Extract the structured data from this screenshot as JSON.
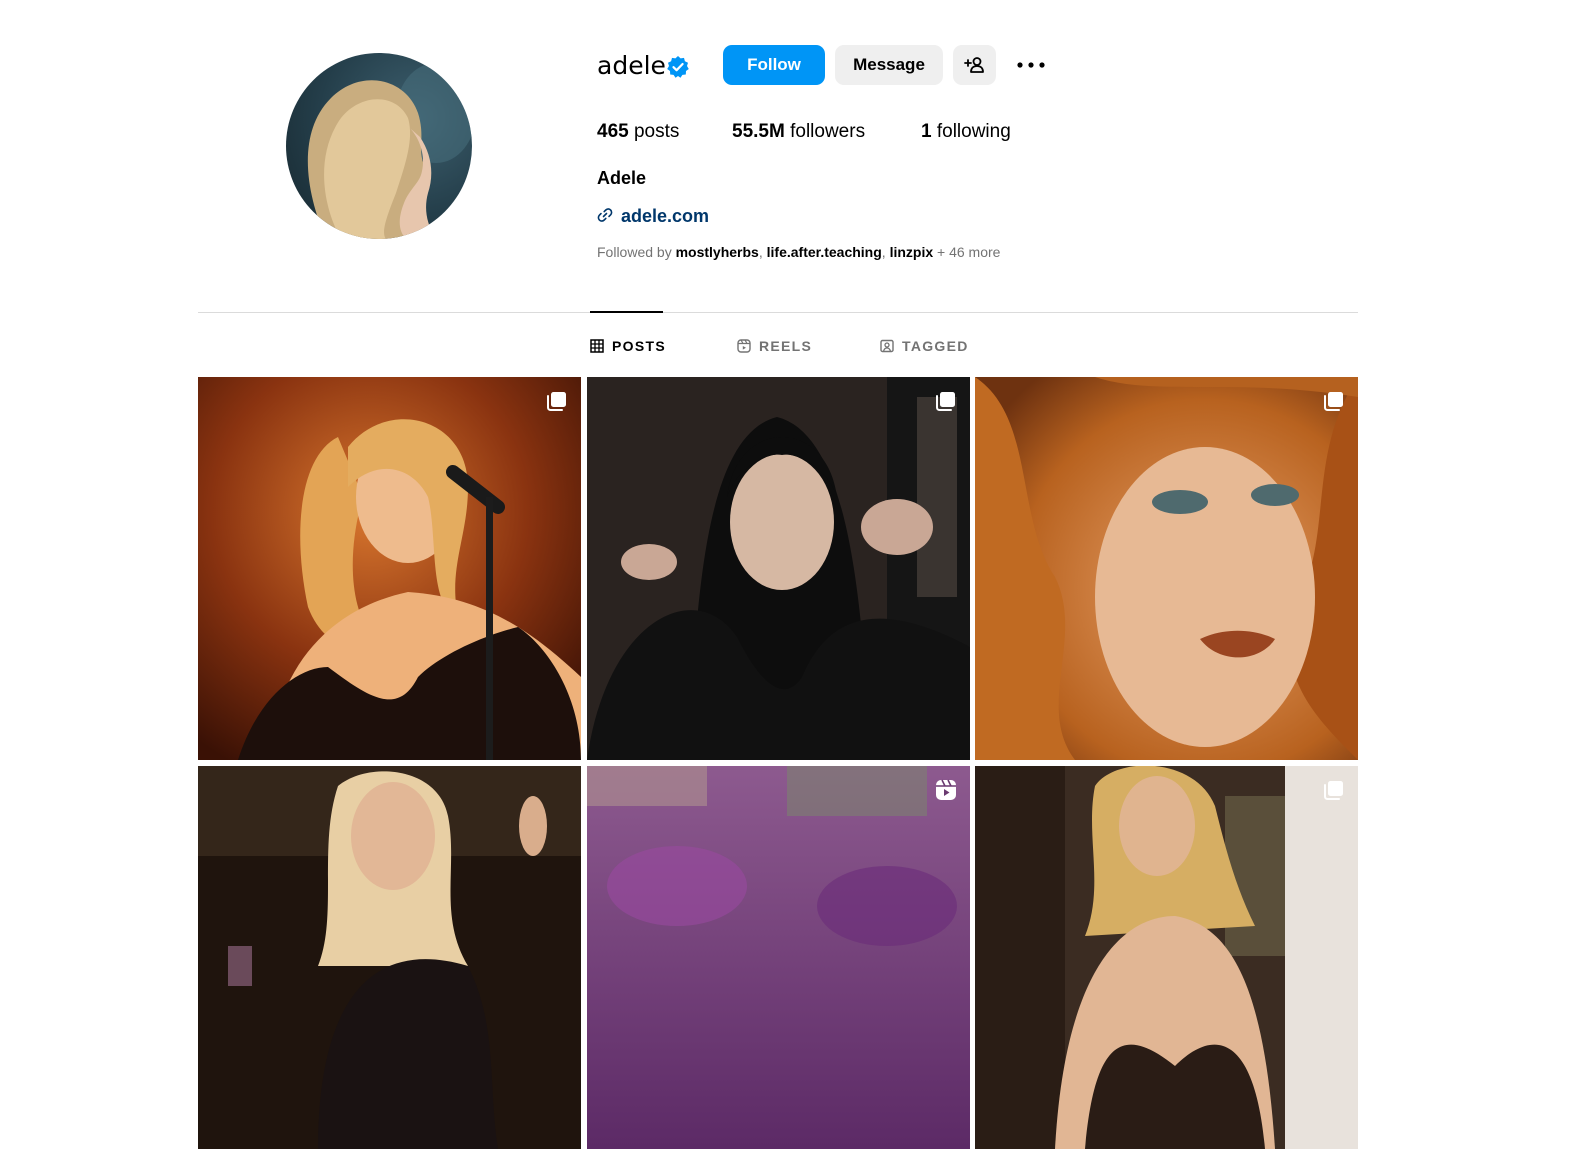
{
  "profile": {
    "username": "adele",
    "full_name": "Adele",
    "website": "adele.com",
    "stats": {
      "posts_count": "465",
      "posts_label": "posts",
      "followers_count": "55.5M",
      "followers_label": "followers",
      "following_count": "1",
      "following_label": "following"
    },
    "followed_by": {
      "prefix": "Followed by ",
      "users": [
        "mostlyherbs",
        "life.after.teaching",
        "linzpix"
      ],
      "suffix": " + 46 more"
    }
  },
  "actions": {
    "follow_label": "Follow",
    "message_label": "Message",
    "add_user_icon": "person-plus-icon",
    "more_icon": "more-dots-icon"
  },
  "tabs": [
    {
      "label": "POSTS",
      "icon": "grid-icon",
      "active": true
    },
    {
      "label": "REELS",
      "icon": "reels-icon",
      "active": false
    },
    {
      "label": "TAGGED",
      "icon": "tagged-icon",
      "active": false
    }
  ],
  "posts": [
    {
      "badge_icon": "carousel-icon"
    },
    {
      "badge_icon": "carousel-icon"
    },
    {
      "badge_icon": "carousel-icon"
    },
    {
      "badge_icon": null
    },
    {
      "badge_icon": "reel-icon"
    },
    {
      "badge_icon": "carousel-icon"
    }
  ],
  "colors": {
    "accent": "#0095f6",
    "secondary_button": "#efefef",
    "link": "#00376b",
    "muted_text": "#737373",
    "verified_badge": "#0095f6"
  }
}
